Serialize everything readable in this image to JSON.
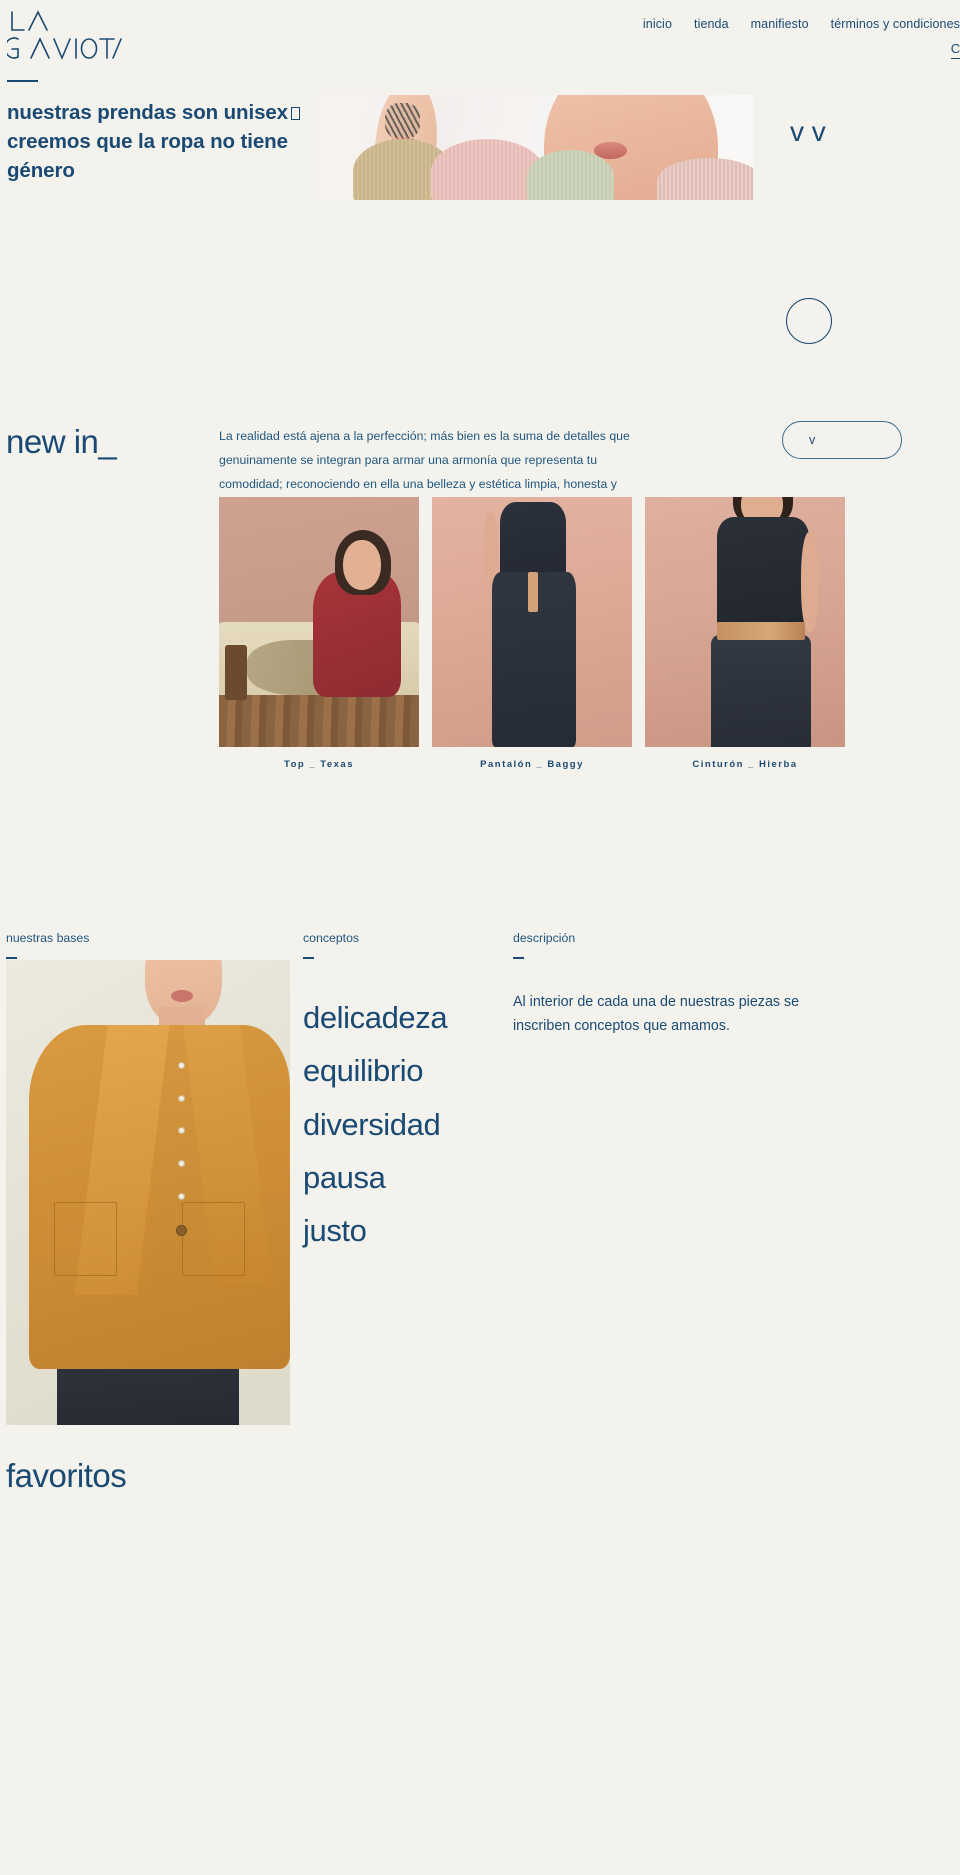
{
  "brand": {
    "name": "LA GAVIOTA",
    "line1": "LA",
    "line2": "GAVIOTA"
  },
  "nav": {
    "items": [
      {
        "label": "inicio",
        "name": "nav-item-inicio"
      },
      {
        "label": "tienda",
        "name": "nav-item-tienda"
      },
      {
        "label": "manifiesto",
        "name": "nav-item-manifiesto"
      },
      {
        "label": "términos y condiciones",
        "name": "nav-item-terminos"
      }
    ],
    "locale": "CL"
  },
  "hero": {
    "headline_part1": "nuestras prendas son unisex",
    "headline_part2": "creemos que la ropa no tiene género",
    "side_text": "v\nv"
  },
  "newin": {
    "title": "new in_",
    "paragraph": "La realidad está ajena a la perfección; más bien es la suma de detalles que genuinamente se integran para armar una armonía que representa tu comodidad; reconociendo en ella una belleza y estética limpia, honesta y perdurable.",
    "cta_label": "v",
    "products": [
      {
        "label": "Top _ Texas"
      },
      {
        "label": "Pantalón _ Baggy"
      },
      {
        "label": "Cinturón _ Hierba"
      }
    ]
  },
  "bases": {
    "col1_heading": "nuestras bases",
    "col2_heading": "conceptos",
    "col3_heading": "descripción",
    "concepts": [
      "delicadeza",
      "equilibrio",
      "diversidad",
      "pausa",
      "justo"
    ],
    "description": "Al interior de cada una de nuestras piezas se\ninscriben conceptos que amamos."
  },
  "favoritos": {
    "title": "favoritos"
  },
  "colors": {
    "background": "#f4f2ec",
    "text_primary": "#1a4a73",
    "text_secondary": "#1f5680",
    "accent_ochre": "#cf8e36",
    "accent_terracotta": "#d7a593"
  }
}
